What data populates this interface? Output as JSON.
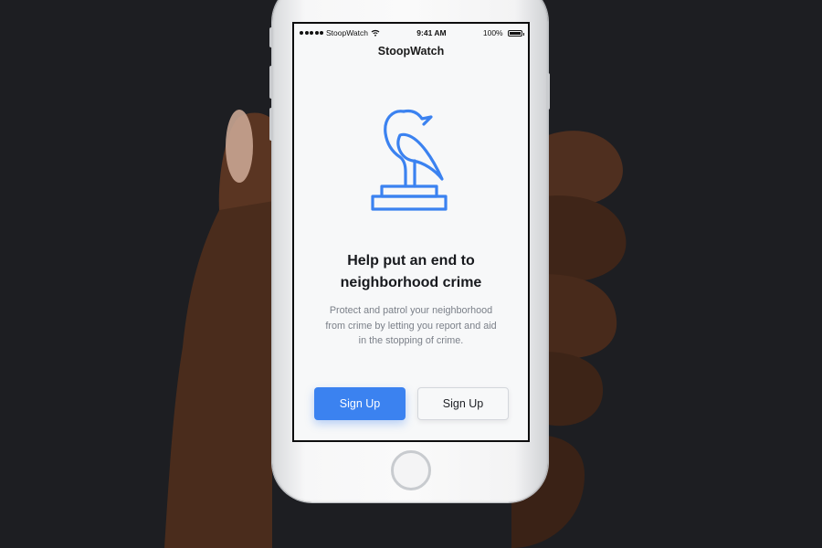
{
  "status_bar": {
    "carrier": "StoopWatch",
    "time": "9:41 AM",
    "battery": "100%"
  },
  "nav": {
    "title": "StoopWatch"
  },
  "hero": {
    "logo_icon": "bird-on-pedestal-icon",
    "headline_line1": "Help put an end to",
    "headline_line2": "neighborhood crime",
    "description_line1": "Protect and patrol your neighborhood",
    "description_line2": "from crime by letting you report and aid",
    "description_line3": "in the stopping of crime."
  },
  "actions": {
    "primary_label": "Sign Up",
    "secondary_label": "Sign Up"
  },
  "colors": {
    "accent": "#3b82f0",
    "background": "#1d1e22"
  }
}
